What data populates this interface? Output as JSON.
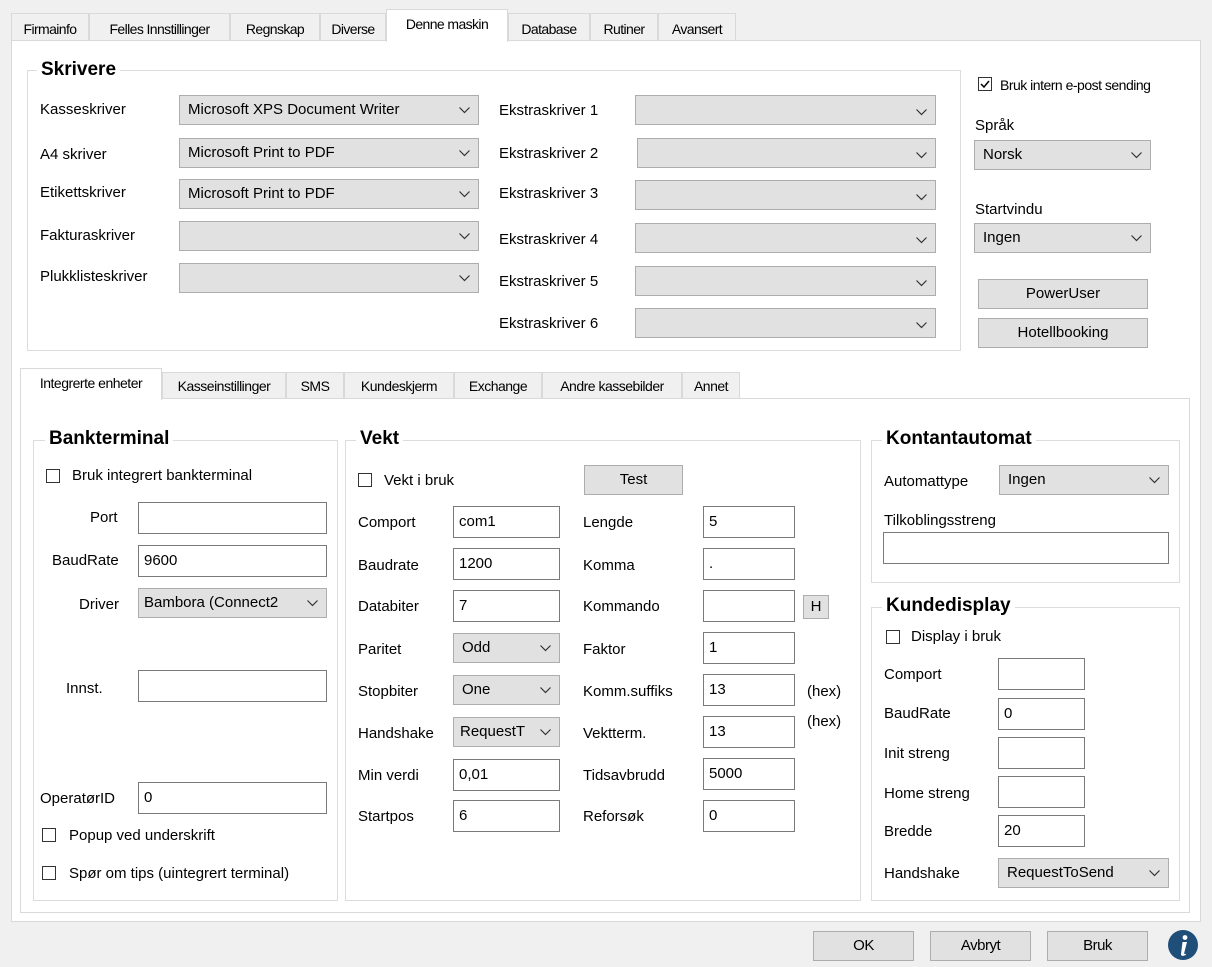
{
  "tabs": [
    "Firmainfo",
    "Felles Innstillinger",
    "Regnskap",
    "Diverse",
    "Denne maskin",
    "Database",
    "Rutiner",
    "Avansert"
  ],
  "printers": {
    "title": "Skrivere",
    "left": [
      {
        "label": "Kasseskriver",
        "value": "Microsoft XPS Document Writer"
      },
      {
        "label": "A4 skriver",
        "value": "Microsoft Print to PDF"
      },
      {
        "label": "Etikettskriver",
        "value": "Microsoft Print to PDF"
      },
      {
        "label": "Fakturaskriver",
        "value": ""
      },
      {
        "label": "Plukklisteskriver",
        "value": ""
      }
    ],
    "right": [
      {
        "label": "Ekstraskriver 1",
        "value": ""
      },
      {
        "label": "Ekstraskriver 2",
        "value": ""
      },
      {
        "label": "Ekstraskriver 3",
        "value": ""
      },
      {
        "label": "Ekstraskriver 4",
        "value": ""
      },
      {
        "label": "Ekstraskriver 5",
        "value": ""
      },
      {
        "label": "Ekstraskriver 6",
        "value": ""
      }
    ]
  },
  "side": {
    "email_label": "Bruk intern e-post sending",
    "email_checked": true,
    "lang_label": "Språk",
    "lang_value": "Norsk",
    "start_label": "Startvindu",
    "start_value": "Ingen",
    "poweruser": "PowerUser",
    "hotel": "Hotellbooking"
  },
  "subtabs": [
    "Integrerte enheter",
    "Kasseinstillinger",
    "SMS",
    "Kundeskjerm",
    "Exchange",
    "Andre kassebilder",
    "Annet"
  ],
  "bank": {
    "title": "Bankterminal",
    "use_label": "Bruk integrert bankterminal",
    "port_label": "Port",
    "port_value": "",
    "baud_label": "BaudRate",
    "baud_value": "9600",
    "driver_label": "Driver",
    "driver_value": "Bambora (Connect2",
    "innst_label": "Innst.",
    "innst_value": "",
    "operator_label": "OperatørID",
    "operator_value": "0",
    "popup_label": "Popup ved underskrift",
    "tips_label": "Spør om tips (uintegrert terminal)"
  },
  "vekt": {
    "title": "Vekt",
    "use_label": "Vekt i bruk",
    "test": "Test",
    "left": [
      {
        "label": "Comport",
        "value": "com1",
        "type": "field"
      },
      {
        "label": "Baudrate",
        "value": "1200",
        "type": "field"
      },
      {
        "label": "Databiter",
        "value": "7",
        "type": "field"
      },
      {
        "label": "Paritet",
        "value": "Odd",
        "type": "combo"
      },
      {
        "label": "Stopbiter",
        "value": "One",
        "type": "combo"
      },
      {
        "label": "Handshake",
        "value": "RequestT",
        "type": "combo"
      },
      {
        "label": "Min verdi",
        "value": "0,01",
        "type": "field"
      },
      {
        "label": "Startpos",
        "value": "6",
        "type": "field"
      }
    ],
    "right": [
      {
        "label": "Lengde",
        "value": "5"
      },
      {
        "label": "Komma",
        "value": "."
      },
      {
        "label": "Kommando",
        "value": ""
      },
      {
        "label": "Faktor",
        "value": "1"
      },
      {
        "label": "Komm.suffiks",
        "value": "13"
      },
      {
        "label": "Vektterm.",
        "value": "13"
      },
      {
        "label": "Tidsavbrudd",
        "value": "5000"
      },
      {
        "label": "Reforsøk",
        "value": "0"
      }
    ],
    "h_button": "H",
    "hex1": "(hex)",
    "hex2": "(hex)"
  },
  "kontant": {
    "title": "Kontantautomat",
    "type_label": "Automattype",
    "type_value": "Ingen",
    "conn_label": "Tilkoblingsstreng",
    "conn_value": ""
  },
  "kunde": {
    "title": "Kundedisplay",
    "use_label": "Display i bruk",
    "rows": [
      {
        "label": "Comport",
        "value": ""
      },
      {
        "label": "BaudRate",
        "value": "0"
      },
      {
        "label": "Init streng",
        "value": ""
      },
      {
        "label": "Home streng",
        "value": ""
      },
      {
        "label": "Bredde",
        "value": "20"
      }
    ],
    "handshake_label": "Handshake",
    "handshake_value": "RequestToSend"
  },
  "buttons": {
    "ok": "OK",
    "cancel": "Avbryt",
    "apply": "Bruk"
  }
}
